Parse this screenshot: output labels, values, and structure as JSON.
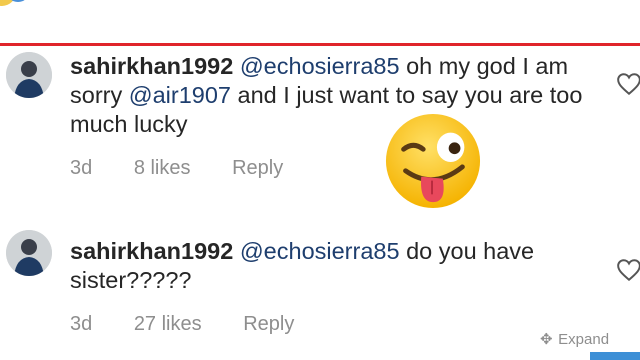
{
  "comments": [
    {
      "username": "sahirkhan1992",
      "mention1": "@echosierra85",
      "text1": " oh my god I am sorry ",
      "mention2": "@air1907",
      "text2": " and I just want to say you are too much lucky",
      "time": "3d",
      "likes": "8 likes",
      "reply": "Reply"
    },
    {
      "username": "sahirkhan1992",
      "mention1": "@echosierra85",
      "text1": " do you have sister?????",
      "time": "3d",
      "likes": "27 likes",
      "reply": "Reply"
    }
  ],
  "footer": {
    "expand_label": "Expand"
  },
  "colors": {
    "divider": "#e0242a",
    "mention": "#1e3e6e",
    "meta": "#8e8e8e",
    "accent": "#3d8fd6"
  },
  "icons": [
    "heart-outline-icon",
    "winking-tongue-emoji",
    "move-expand-icon"
  ]
}
